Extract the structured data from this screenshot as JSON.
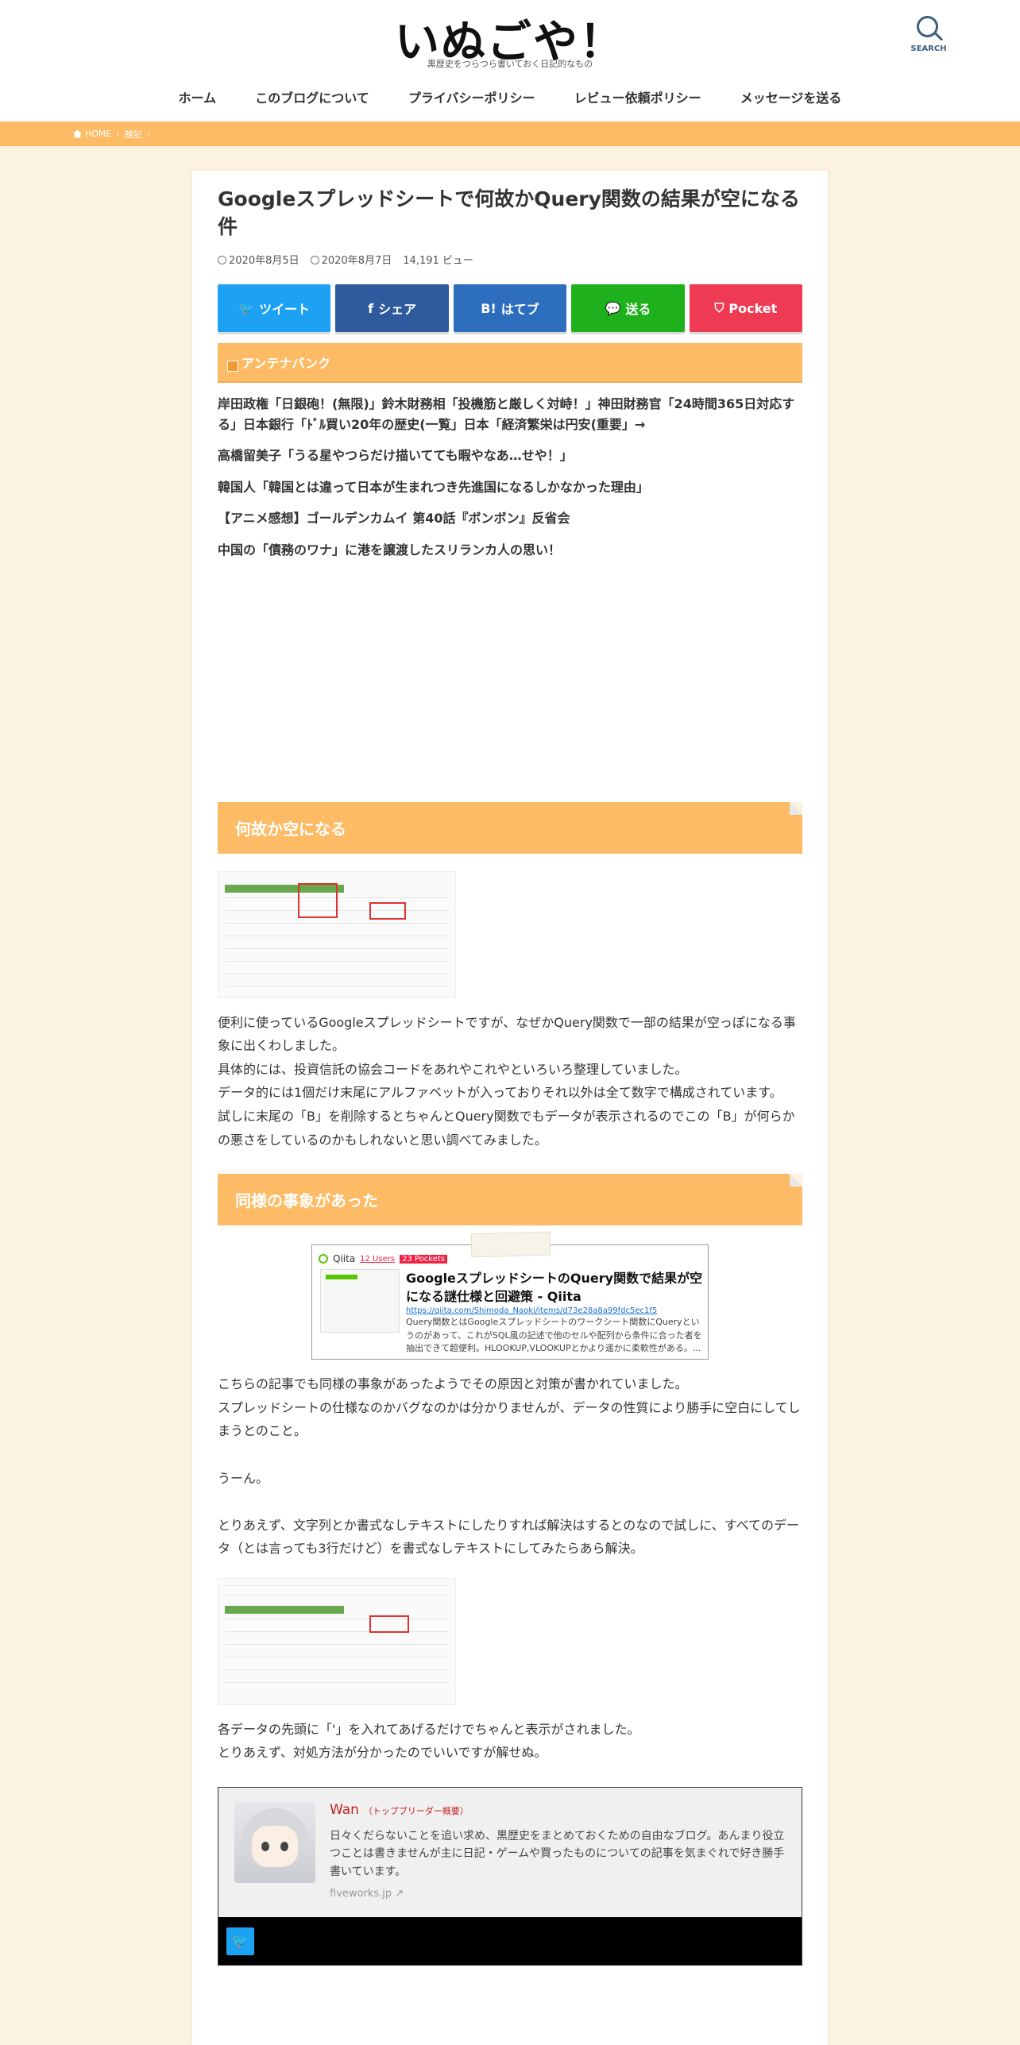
{
  "site": {
    "title": "いぬごや！",
    "description": "黒歴史をつらつら書いておく日記的なもの",
    "search_label": "SEARCH"
  },
  "nav": [
    "ホーム",
    "このブログについて",
    "プライバシーポリシー",
    "レビュー依頼ポリシー",
    "メッセージを送る"
  ],
  "breadcrumb": {
    "home": "HOME",
    "category": "雑記",
    "sep": "›"
  },
  "article": {
    "title": "Googleスプレッドシートで何故かQuery関数の結果が空になる件",
    "published": "2020年8月5日",
    "updated": "2020年8月7日",
    "views": "14,191 ビュー"
  },
  "share": [
    {
      "label": "ツイート",
      "glyph": "🐦",
      "color": "#1da1f2"
    },
    {
      "label": "シェア",
      "glyph": "f",
      "color": "#2f5b9e"
    },
    {
      "label": "はてブ",
      "glyph": "B!",
      "color": "#2c6ebd"
    },
    {
      "label": "送る",
      "glyph": "💬",
      "color": "#1fb01d"
    },
    {
      "label": "Pocket",
      "glyph": "⛉",
      "color": "#ef3a53"
    }
  ],
  "antenna": {
    "heading": "アンテナバンク",
    "items": [
      "岸田政権「日銀砲！(無限)」鈴木財務相「投機筋と厳しく対峙！」神田財務官「24時間365日対応する」日本銀行「ﾄﾞﾙ買い20年の歴史(一覧」日本「経済繁栄は円安(重要」→",
      "高橋留美子「うる星やつらだけ描いてても暇やなあ…せや！」",
      "韓国人「韓国とは違って日本が生まれつき先進国になるしかなかった理由」",
      "【アニメ感想】ゴールデンカムイ 第40話『ボンボン』反省会",
      "中国の「債務のワナ」に港を譲渡したスリランカ人の思い！"
    ]
  },
  "section1": {
    "heading": "何故か空になる",
    "paragraphs": [
      "便利に使っているGoogleスプレッドシートですが、なぜかQuery関数で一部の結果が空っぽになる事象に出くわしました。",
      "具体的には、投資信託の協会コードをあれやこれやといろいろ整理していました。",
      "データ的には1個だけ末尾にアルファベットが入っておりそれ以外は全て数字で構成されています。",
      "試しに末尾の「B」を削除するとちゃんとQuery関数でもデータが表示されるのでこの「B」が何らかの悪さをしているのかもしれないと思い調べてみました。"
    ]
  },
  "section2": {
    "heading": "同様の事象があった",
    "card": {
      "site": "Qiita",
      "users": "12 Users",
      "pockets": "23 Pockets",
      "title": "GoogleスプレッドシートのQuery関数で結果が空になる謎仕様と回避策 - Qiita",
      "url": "https://qiita.com/Shimoda_Naoki/items/d73e28a8a99fdc5ec1f5",
      "desc": "Query関数とはGoogleスプレッドシートのワークシート関数にQueryというのがあって、これがSQL風の記述で他のセルや配列から条件に合った者を抽出できて超便利。HLOOKUP,VLOOKUPとかより遥かに柔軟性がある。..."
    },
    "para1": [
      "こちらの記事でも同様の事象があったようでその原因と対策が書かれていました。",
      "スプレッドシートの仕様なのかバグなのかは分かりませんが、データの性質により勝手に空白にしてしまうとのこと。"
    ],
    "para2": "うーん。",
    "para3": "とりあえず、文字列とか書式なしテキストにしたりすれば解決はするとのなので試しに、すべてのデータ（とは言っても3行だけど）を書式なしテキストにしてみたらあら解決。",
    "para4": [
      "各データの先頭に「'」を入れてあげるだけでちゃんと表示がされました。",
      "とりあえず、対処方法が分かったのでいいですが解せぬ。"
    ]
  },
  "author": {
    "name": "Wan",
    "role": "（トップブリーダー概要）",
    "desc": "日々くだらないことを追い求め、黒歴史をまとめておくための自由なブログ。あんまり役立つことは書きませんが主に日記・ゲームや買ったものについての記事を気まぐれで好き勝手書いています。",
    "site": "fiveworks.jp"
  }
}
